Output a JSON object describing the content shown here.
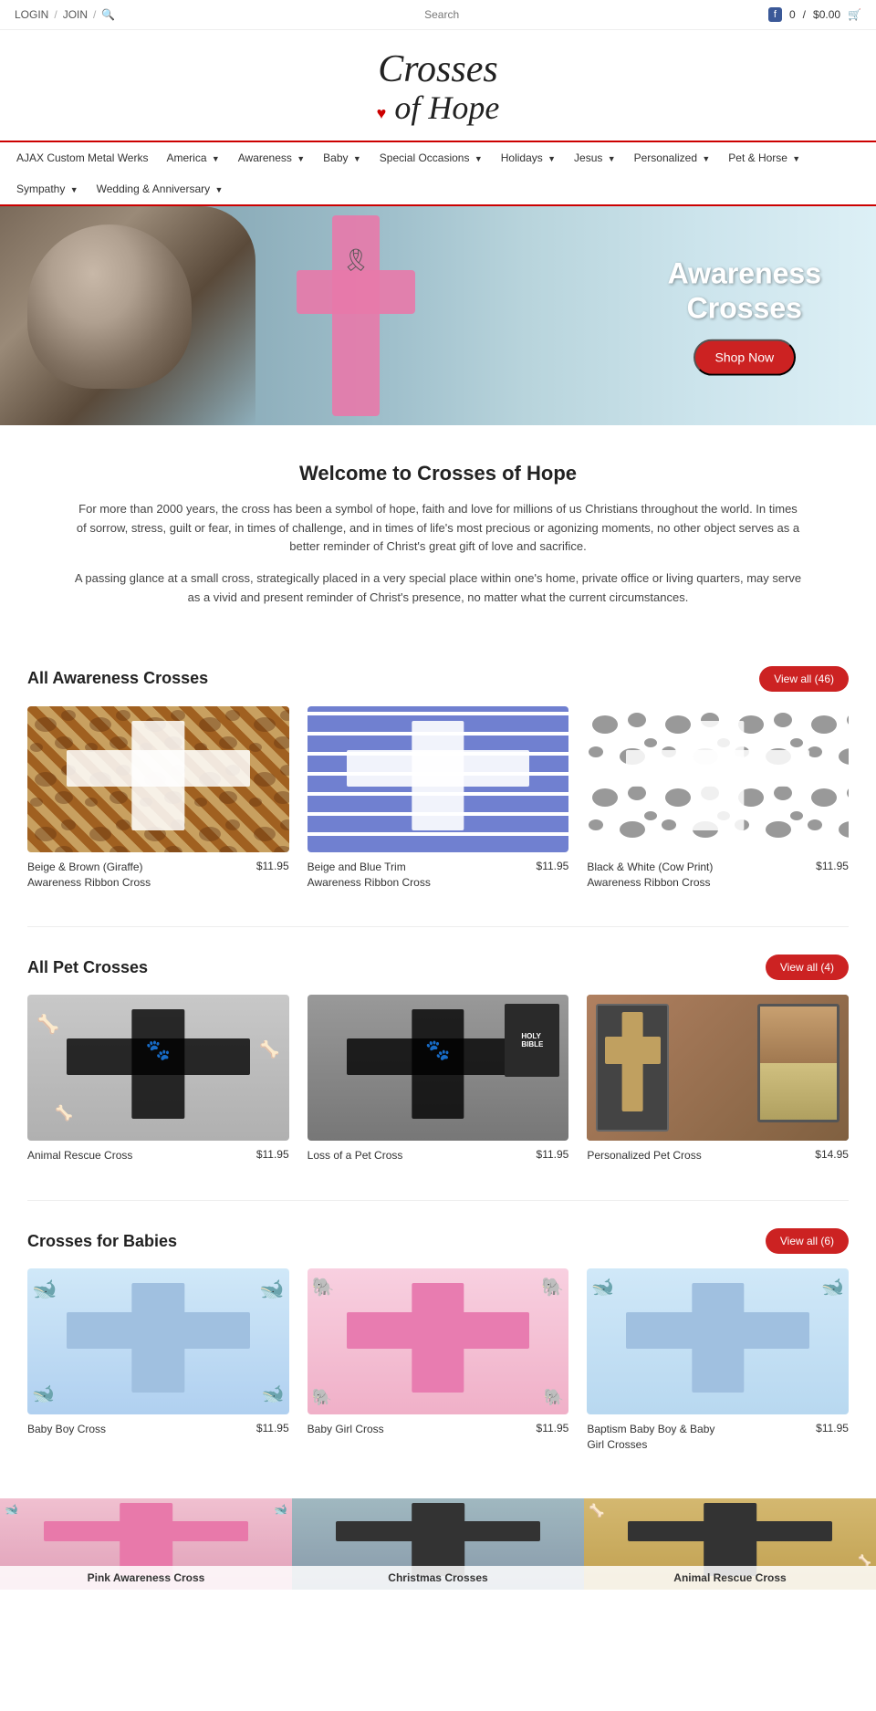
{
  "topbar": {
    "login": "LOGIN",
    "join": "JOIN",
    "search_label": "Search",
    "cart_count": "0",
    "cart_price": "$0.00"
  },
  "logo": {
    "line1": "Crosses",
    "line2": "of Hope"
  },
  "nav": {
    "items": [
      {
        "label": "AJAX Custom Metal Werks",
        "has_dropdown": false
      },
      {
        "label": "America",
        "has_dropdown": true
      },
      {
        "label": "Awareness",
        "has_dropdown": true
      },
      {
        "label": "Baby",
        "has_dropdown": true
      },
      {
        "label": "Special Occasions",
        "has_dropdown": true
      },
      {
        "label": "Holidays",
        "has_dropdown": true
      },
      {
        "label": "Jesus",
        "has_dropdown": true
      },
      {
        "label": "Personalized",
        "has_dropdown": true
      },
      {
        "label": "Pet & Horse",
        "has_dropdown": true
      },
      {
        "label": "Sympathy",
        "has_dropdown": true
      },
      {
        "label": "Wedding & Anniversary",
        "has_dropdown": true
      }
    ]
  },
  "hero": {
    "title_line1": "Awareness",
    "title_line2": "Crosses",
    "button_label": "Shop Now"
  },
  "welcome": {
    "title": "Welcome to Crosses of Hope",
    "paragraph1": "For more than 2000 years, the cross has been a symbol of hope, faith and love for millions of us Christians throughout the world. In times of sorrow, stress, guilt or fear, in times of challenge, and in times of life's most precious or agonizing moments, no other object serves as a better reminder of Christ's great gift of love and sacrifice.",
    "paragraph2": "A passing glance at a small cross, strategically placed in a very special place within one's home, private office or living quarters, may serve as a vivid and present reminder of Christ's presence, no matter what the current circumstances."
  },
  "awareness_section": {
    "title": "All Awareness Crosses",
    "view_all_label": "View all (46)",
    "products": [
      {
        "name": "Beige & Brown (Giraffe)\nAwareness Ribbon Cross",
        "price": "$11.95",
        "image_type": "giraffe"
      },
      {
        "name": "Beige and Blue Trim\nAwareness Ribbon Cross",
        "price": "$11.95",
        "image_type": "blue-stripes"
      },
      {
        "name": "Black & White (Cow Print)\nAwareness Ribbon Cross",
        "price": "$11.95",
        "image_type": "cow"
      }
    ]
  },
  "pet_section": {
    "title": "All Pet Crosses",
    "view_all_label": "View all (4)",
    "products": [
      {
        "name": "Animal Rescue Cross",
        "price": "$11.95",
        "image_type": "animal-rescue"
      },
      {
        "name": "Loss of a Pet Cross",
        "price": "$11.95",
        "image_type": "loss-pet"
      },
      {
        "name": "Personalized Pet Cross",
        "price": "$14.95",
        "image_type": "pers-pet"
      }
    ]
  },
  "baby_section": {
    "title": "Crosses for Babies",
    "view_all_label": "View all (6)",
    "products": [
      {
        "name": "Baby Boy Cross",
        "price": "$11.95",
        "image_type": "baby-boy"
      },
      {
        "name": "Baby Girl Cross",
        "price": "$11.95",
        "image_type": "baby-girl"
      },
      {
        "name": "Baptism Baby Boy & Baby\nGirl Crosses",
        "price": "$11.95",
        "image_type": "baptism"
      }
    ]
  },
  "bottom_teasers": [
    {
      "label": "Pink Awareness Cross",
      "image_type": "pink-awareness"
    },
    {
      "label": "Christmas Crosses",
      "image_type": "christmas"
    },
    {
      "label": "Animal Rescue Cross",
      "image_type": "animal-rescue2"
    }
  ]
}
